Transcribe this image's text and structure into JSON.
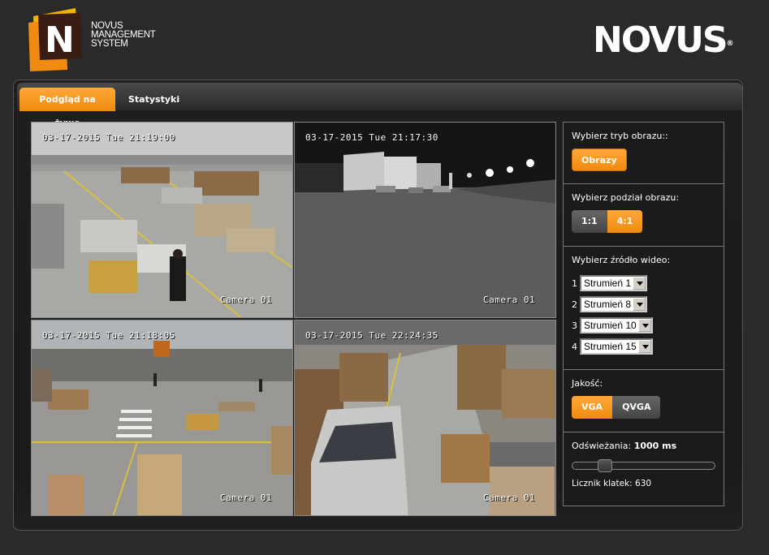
{
  "header": {
    "brand_lines": [
      "NOVUS",
      "MANAGEMENT",
      "SYSTEM"
    ],
    "brand_logo_letter": "N",
    "vendor_logo": "NOVUS",
    "vendor_logo_mark": "®"
  },
  "tabs": [
    {
      "label": "Podgląd na żywo",
      "active": true
    },
    {
      "label": "Statystyki",
      "active": false
    }
  ],
  "cameras": [
    {
      "timestamp": "03-17-2015 Tue 21:19:00",
      "name": "Camera 01"
    },
    {
      "timestamp": "03-17-2015 Tue 21:17:30",
      "name": "Camera 01"
    },
    {
      "timestamp": "03-17-2015 Tue 21:18:05",
      "name": "Camera 01"
    },
    {
      "timestamp": "03-17-2015 Tue 22:24:35",
      "name": "Camera 01"
    }
  ],
  "controls": {
    "image_mode": {
      "label": "Wybierz tryb obrazu::",
      "button": "Obrazy"
    },
    "split": {
      "label": "Wybierz podział obrazu:",
      "options": [
        "1:1",
        "4:1"
      ],
      "selected": "4:1"
    },
    "source": {
      "label": "Wybierz źródło wideo:",
      "rows": [
        {
          "num": "1",
          "value": "Strumień 1"
        },
        {
          "num": "2",
          "value": "Strumień 8"
        },
        {
          "num": "3",
          "value": "Strumień 10"
        },
        {
          "num": "4",
          "value": "Strumień 15"
        }
      ]
    },
    "quality": {
      "label": "Jakość:",
      "options": [
        "VGA",
        "QVGA"
      ],
      "selected": "VGA"
    },
    "refresh": {
      "label": "Odświeżania:",
      "value": "1000 ms",
      "slider_fraction": 0.2
    },
    "frame_counter": {
      "label": "Licznik klatek:",
      "value": "630"
    }
  },
  "colors": {
    "accent": "#f5961e",
    "background": "#2a2a2a"
  }
}
